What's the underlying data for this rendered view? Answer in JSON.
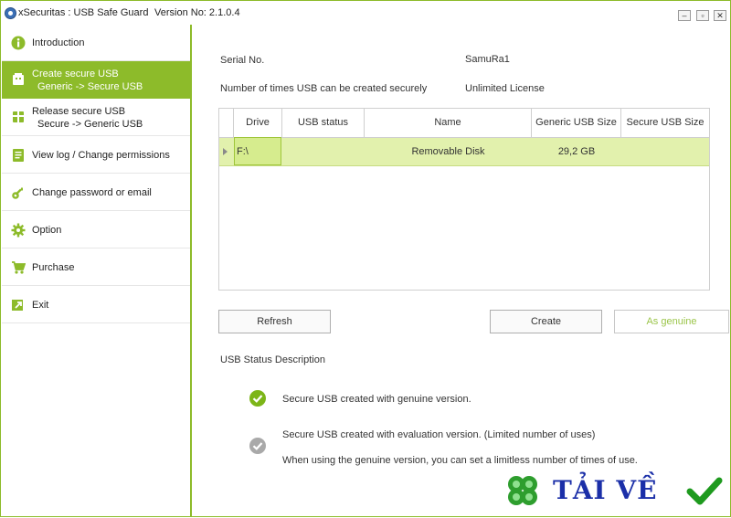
{
  "titlebar": {
    "app_title": "xSecuritas : USB Safe Guard",
    "version": "Version No: 2.1.0.4",
    "minimize": "–",
    "maximize": "▫",
    "close": "✕"
  },
  "sidebar": {
    "items": [
      {
        "label": "Introduction",
        "icon": "info-icon"
      },
      {
        "label": "Create secure USB",
        "sublabel": "Generic -> Secure USB",
        "icon": "usb-icon",
        "active": true
      },
      {
        "label": "Release secure USB",
        "sublabel": "Secure -> Generic USB",
        "icon": "release-icon"
      },
      {
        "label": "View log / Change permissions",
        "icon": "log-icon"
      },
      {
        "label": "Change password or email",
        "icon": "key-icon"
      },
      {
        "label": "Option",
        "icon": "gear-icon"
      },
      {
        "label": "Purchase",
        "icon": "cart-icon"
      },
      {
        "label": "Exit",
        "icon": "exit-icon"
      }
    ]
  },
  "main": {
    "serial_label": "Serial No.",
    "serial_value": "SamuRa1",
    "count_label": "Number of times USB can be created securely",
    "count_value": "Unlimited License",
    "table": {
      "columns": [
        "Drive",
        "USB status",
        "Name",
        "Generic USB Size",
        "Secure USB Size"
      ],
      "rows": [
        {
          "drive": "F:\\",
          "status": "",
          "name": "Removable Disk",
          "generic_size": "29,2 GB",
          "secure_size": ""
        }
      ]
    },
    "buttons": {
      "refresh": "Refresh",
      "create": "Create",
      "as_genuine": "As genuine"
    },
    "status_desc": {
      "title": "USB Status Description",
      "genuine": "Secure USB created with genuine version.",
      "evaluation": "Secure USB created with evaluation version. (Limited number of uses)",
      "evaluation_note": "When using the genuine version, you can set a limitless number of times of use."
    }
  },
  "watermark": {
    "text": "TẢI VỀ"
  },
  "colors": {
    "accent": "#8dbb2a",
    "row_highlight": "#e2f1ad",
    "genuine_icon": "#7cb518",
    "evaluation_icon": "#a9a9a9",
    "watermark_text": "#1b2fa8"
  }
}
